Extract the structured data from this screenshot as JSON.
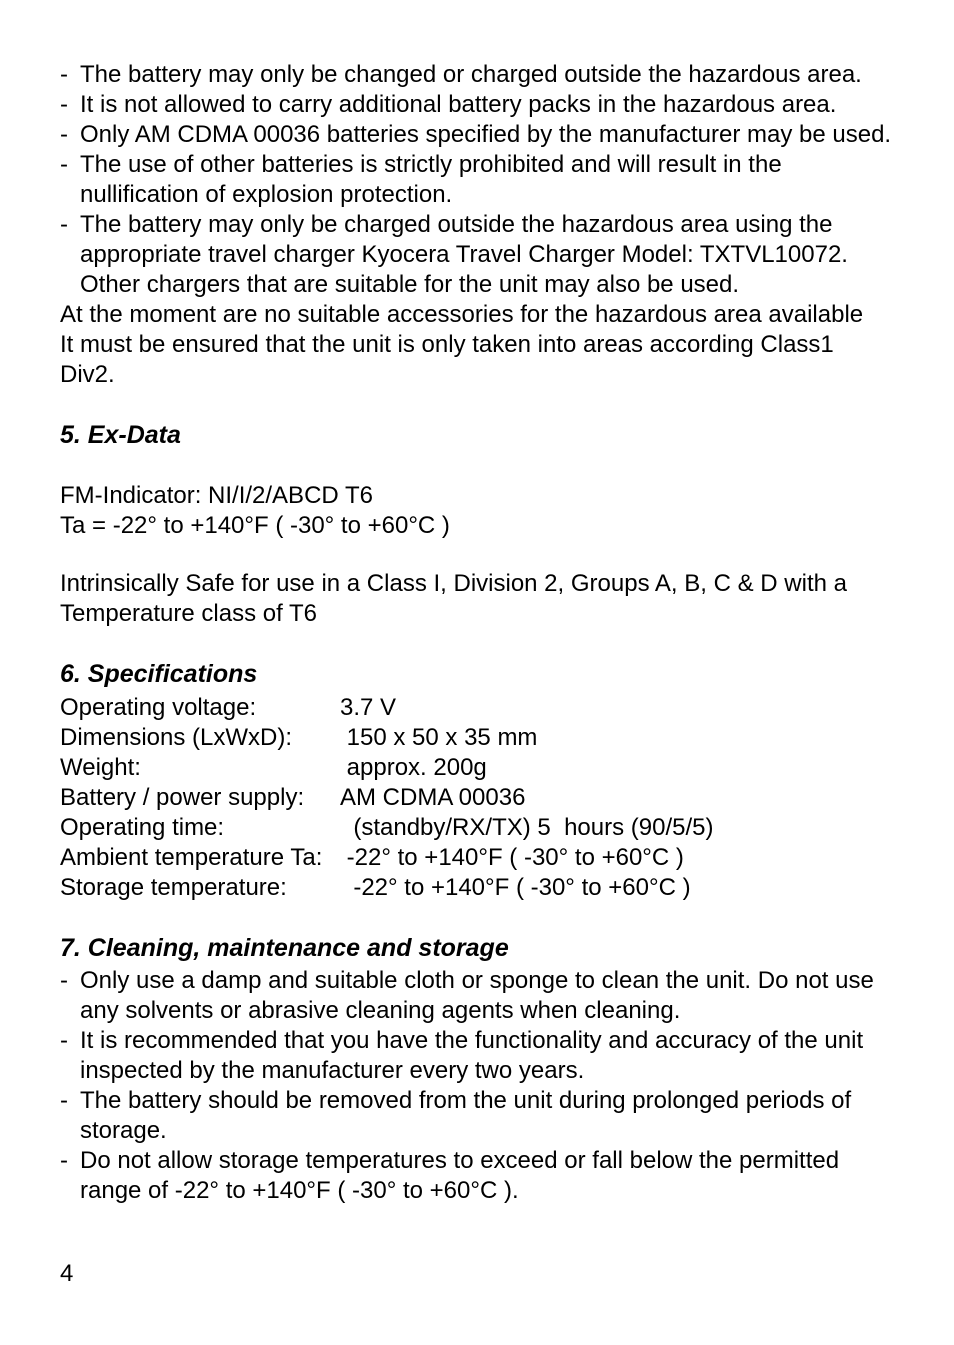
{
  "bullets_top": [
    "The battery may only be changed or charged outside the hazardous area.",
    "It is not allowed to carry additional battery packs in the  hazardous area.",
    "Only AM CDMA 00036 batteries specified by the manufacturer may be used.",
    "The use of other batteries is strictly prohibited and will result in the nullification of explosion protection.",
    "The battery may only be charged outside the hazardous area using the appropriate travel charger Kyocera Travel Charger Model: TXTVL10072. Other chargers that are suitable for the unit may also be used."
  ],
  "para_top_1": "At the moment are no suitable accessories for the hazardous area available",
  "para_top_2": "It must be ensured that the unit is only taken into areas according Class1 Div2.",
  "section5": {
    "heading": "5. Ex-Data",
    "line1": "FM-Indicator: NI/I/2/ABCD T6",
    "line2": "Ta = -22° to +140°F ( -30° to +60°C )",
    "line3": "Intrinsically Safe for use in a Class I, Division 2, Groups A, B, C & D with a Temperature class of T6"
  },
  "section6": {
    "heading": "6. Specifications",
    "rows": [
      {
        "label": "Operating voltage:",
        "value": "3.7 V"
      },
      {
        "label": "Dimensions (LxWxD):",
        "value": " 150 x 50 x 35 mm"
      },
      {
        "label": "Weight:",
        "value": " approx. 200g"
      },
      {
        "label": "Battery / power supply:",
        "value": "AM CDMA 00036"
      },
      {
        "label": "Operating time:",
        "value": "  (standby/RX/TX) 5  hours (90/5/5)"
      },
      {
        "label": "Ambient temperature Ta:",
        "value": " -22° to +140°F ( -30° to +60°C )"
      },
      {
        "label": "Storage temperature:",
        "value": "  -22° to +140°F ( -30° to +60°C )"
      }
    ]
  },
  "section7": {
    "heading": "7. Cleaning, maintenance and storage",
    "bullets": [
      "Only use a damp and suitable cloth or sponge to clean the unit. Do not use any solvents or abrasive cleaning agents when cleaning.",
      "It is recommended that you have the functionality and accuracy of the unit inspected by the manufacturer every two years.",
      "The battery should be removed from the unit during prolonged periods of storage.",
      "Do not allow storage temperatures to exceed or fall below the permitted range of -22° to +140°F ( -30° to +60°C )."
    ]
  },
  "page_number": "4"
}
